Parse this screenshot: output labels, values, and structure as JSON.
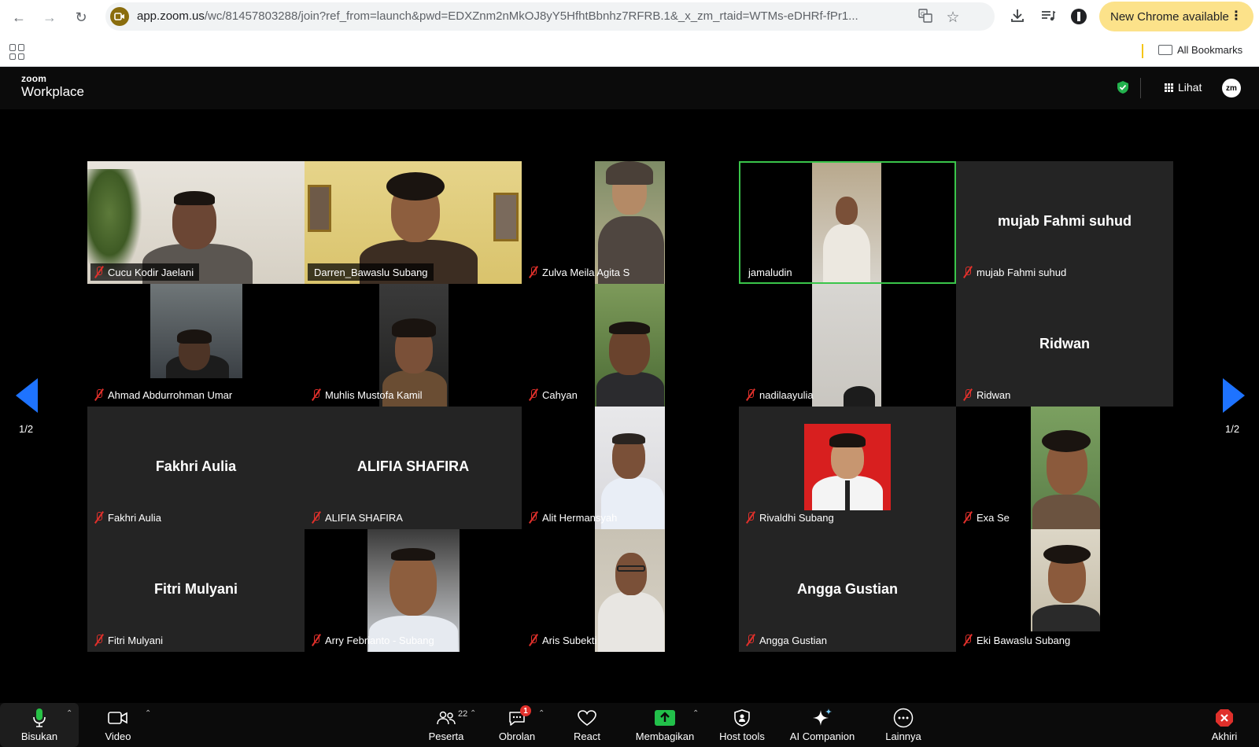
{
  "browser": {
    "url_host": "app.zoom.us",
    "url_path": "/wc/81457803288/join?ref_from=launch&pwd=EDXZnm2nMkOJ8yY5HfhtBbnhz7RFRB.1&_x_zm_rtaid=WTMs-eDHRf-fPr1...",
    "update_label": "New Chrome available",
    "bookmarks_label": "All Bookmarks"
  },
  "zoom": {
    "logo_small": "zoom",
    "logo_big": "Workplace",
    "view_label": "Lihat",
    "avatar_initials": "zm"
  },
  "page_indicator_left": "1/2",
  "page_indicator_right": "1/2",
  "participants": [
    {
      "name": "Cucu Kodir Jaelani",
      "big": ""
    },
    {
      "name": "Darren_Bawaslu Subang",
      "big": ""
    },
    {
      "name": "Zulva Meila Agita S",
      "big": ""
    },
    {
      "name": "jamaludin",
      "big": ""
    },
    {
      "name": "mujab Fahmi suhud",
      "big": "mujab Fahmi suhud"
    },
    {
      "name": "Ahmad Abdurrohman Umar",
      "big": ""
    },
    {
      "name": "Muhlis Mustofa Kamil",
      "big": ""
    },
    {
      "name": "Cahyan",
      "big": ""
    },
    {
      "name": "nadilaayulia",
      "big": ""
    },
    {
      "name": "Ridwan",
      "big": "Ridwan"
    },
    {
      "name": "Fakhri Aulia",
      "big": "Fakhri Aulia"
    },
    {
      "name": "ALIFIA SHAFIRA",
      "big": "ALIFIA SHAFIRA"
    },
    {
      "name": "Alit Hermansyah",
      "big": ""
    },
    {
      "name": "Rivaldhi Subang",
      "big": ""
    },
    {
      "name": "Exa Se",
      "big": ""
    },
    {
      "name": "Fitri Mulyani",
      "big": "Fitri Mulyani"
    },
    {
      "name": "Arry Febrianto - Subang",
      "big": ""
    },
    {
      "name": "Aris Subekti",
      "big": ""
    },
    {
      "name": "Angga Gustian",
      "big": "Angga Gustian"
    },
    {
      "name": "Eki Bawaslu Subang",
      "big": ""
    }
  ],
  "toolbar": {
    "mute_label": "Bisukan",
    "video_label": "Video",
    "participants_label": "Peserta",
    "participants_count": "22",
    "chat_label": "Obrolan",
    "chat_badge": "1",
    "react_label": "React",
    "share_label": "Membagikan",
    "host_tools_label": "Host tools",
    "ai_label": "AI Companion",
    "more_label": "Lainnya",
    "end_label": "Akhiri"
  }
}
